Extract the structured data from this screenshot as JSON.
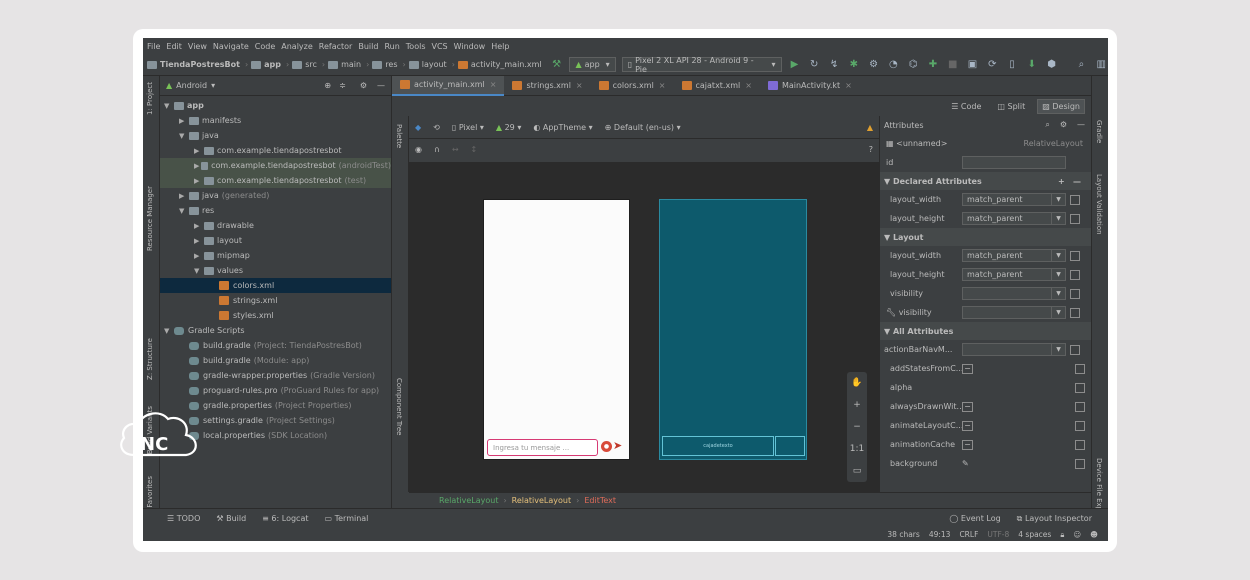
{
  "menu": [
    "File",
    "Edit",
    "View",
    "Navigate",
    "Code",
    "Analyze",
    "Refactor",
    "Build",
    "Run",
    "Tools",
    "VCS",
    "Window",
    "Help"
  ],
  "breadcrumb": [
    "TiendaPostresBot",
    "app",
    "src",
    "main",
    "res",
    "layout",
    "activity_main.xml"
  ],
  "run_config": "app",
  "device": "Pixel 2 XL API 28 - Android 9 - Pie",
  "left_strip": [
    "1: Project",
    "Resource Manager",
    "Z: Structure",
    "Build Variants",
    "2: Favorites"
  ],
  "right_strip": [
    "Gradle",
    "Layout Validation",
    "Device File Explorer"
  ],
  "project_panel": {
    "view": "Android",
    "tree": [
      {
        "label": "app",
        "note": "",
        "depth": 0,
        "arrow": "▼",
        "icon": "folder",
        "state": "",
        "bold": true
      },
      {
        "label": "manifests",
        "note": "",
        "depth": 1,
        "arrow": "▶",
        "icon": "folder",
        "state": ""
      },
      {
        "label": "java",
        "note": "",
        "depth": 1,
        "arrow": "▼",
        "icon": "folder",
        "state": ""
      },
      {
        "label": "com.example.tiendapostresbot",
        "note": "",
        "depth": 2,
        "arrow": "▶",
        "icon": "folder",
        "state": ""
      },
      {
        "label": "com.example.tiendapostresbot",
        "note": "(androidTest)",
        "depth": 2,
        "arrow": "▶",
        "icon": "folder",
        "state": "hl"
      },
      {
        "label": "com.example.tiendapostresbot",
        "note": "(test)",
        "depth": 2,
        "arrow": "▶",
        "icon": "folder",
        "state": "hl"
      },
      {
        "label": "java",
        "note": "(generated)",
        "depth": 1,
        "arrow": "▶",
        "icon": "folder",
        "state": ""
      },
      {
        "label": "res",
        "note": "",
        "depth": 1,
        "arrow": "▼",
        "icon": "folder",
        "state": ""
      },
      {
        "label": "drawable",
        "note": "",
        "depth": 2,
        "arrow": "▶",
        "icon": "folder",
        "state": ""
      },
      {
        "label": "layout",
        "note": "",
        "depth": 2,
        "arrow": "▶",
        "icon": "folder",
        "state": ""
      },
      {
        "label": "mipmap",
        "note": "",
        "depth": 2,
        "arrow": "▶",
        "icon": "folder",
        "state": ""
      },
      {
        "label": "values",
        "note": "",
        "depth": 2,
        "arrow": "▼",
        "icon": "folder",
        "state": ""
      },
      {
        "label": "colors.xml",
        "note": "",
        "depth": 3,
        "arrow": "",
        "icon": "xml",
        "state": "sel"
      },
      {
        "label": "strings.xml",
        "note": "",
        "depth": 3,
        "arrow": "",
        "icon": "xml",
        "state": ""
      },
      {
        "label": "styles.xml",
        "note": "",
        "depth": 3,
        "arrow": "",
        "icon": "xml",
        "state": ""
      },
      {
        "label": "Gradle Scripts",
        "note": "",
        "depth": 0,
        "arrow": "▼",
        "icon": "gradle",
        "state": ""
      },
      {
        "label": "build.gradle",
        "note": "(Project: TiendaPostresBot)",
        "depth": 1,
        "arrow": "",
        "icon": "gradle",
        "state": ""
      },
      {
        "label": "build.gradle",
        "note": "(Module: app)",
        "depth": 1,
        "arrow": "",
        "icon": "gradle",
        "state": ""
      },
      {
        "label": "gradle-wrapper.properties",
        "note": "(Gradle Version)",
        "depth": 1,
        "arrow": "",
        "icon": "gradle",
        "state": ""
      },
      {
        "label": "proguard-rules.pro",
        "note": "(ProGuard Rules for app)",
        "depth": 1,
        "arrow": "",
        "icon": "gradle",
        "state": ""
      },
      {
        "label": "gradle.properties",
        "note": "(Project Properties)",
        "depth": 1,
        "arrow": "",
        "icon": "gradle",
        "state": ""
      },
      {
        "label": "settings.gradle",
        "note": "(Project Settings)",
        "depth": 1,
        "arrow": "",
        "icon": "gradle",
        "state": ""
      },
      {
        "label": "local.properties",
        "note": "(SDK Location)",
        "depth": 1,
        "arrow": "",
        "icon": "gradle",
        "state": ""
      }
    ]
  },
  "tabs": [
    {
      "label": "activity_main.xml",
      "active": true
    },
    {
      "label": "strings.xml",
      "active": false
    },
    {
      "label": "colors.xml",
      "active": false
    },
    {
      "label": "cajatxt.xml",
      "active": false
    },
    {
      "label": "MainActivity.kt",
      "active": false
    }
  ],
  "view_modes": {
    "code": "Code",
    "split": "Split",
    "design": "Design"
  },
  "design_toolbar": {
    "device": "Pixel",
    "api": "29",
    "theme": "AppTheme",
    "locale": "Default (en-us)"
  },
  "palette_label": "Palette",
  "component_tree_label": "Component Tree",
  "preview": {
    "placeholder": "Ingresa tu mensaje ...",
    "blueprint_label": "cajadetexto",
    "colors": {
      "input_border": "#d63a74",
      "send": "#c0392b",
      "blueprint": "#0d5a6c"
    }
  },
  "zoom_controls": [
    "✋",
    "+",
    "−",
    "1:1",
    "▭"
  ],
  "attributes": {
    "title": "Attributes",
    "component": "<unnamed>",
    "component_type": "RelativeLayout",
    "id_label": "id",
    "declared_title": "Declared Attributes",
    "declared": [
      {
        "k": "layout_width",
        "v": "match_parent"
      },
      {
        "k": "layout_height",
        "v": "match_parent"
      }
    ],
    "layout_title": "Layout",
    "layout": [
      {
        "k": "layout_width",
        "v": "match_parent"
      },
      {
        "k": "layout_height",
        "v": "match_parent"
      },
      {
        "k": "visibility",
        "v": ""
      },
      {
        "k": "visibility",
        "v": "",
        "wrench": true
      }
    ],
    "all_title": "All Attributes",
    "all": [
      {
        "k": "actionBarNavM...",
        "type": "dd"
      },
      {
        "k": "addStatesFromC...",
        "type": "chk"
      },
      {
        "k": "alpha",
        "type": "text"
      },
      {
        "k": "alwaysDrawnWit...",
        "type": "chk"
      },
      {
        "k": "animateLayoutC...",
        "type": "chk"
      },
      {
        "k": "animationCache",
        "type": "chk"
      },
      {
        "k": "background",
        "type": "pick"
      }
    ]
  },
  "bottom_breadcrumb": [
    "RelativeLayout",
    "RelativeLayout",
    "EditText"
  ],
  "bottom_tools": [
    "TODO",
    "Build",
    "6: Logcat",
    "Terminal"
  ],
  "bottom_right_tools": [
    "Event Log",
    "Layout Inspector"
  ],
  "status": [
    "38 chars",
    "49:13",
    "CRLF",
    "UTF-8",
    "4 spaces"
  ],
  "watermark": "NC"
}
